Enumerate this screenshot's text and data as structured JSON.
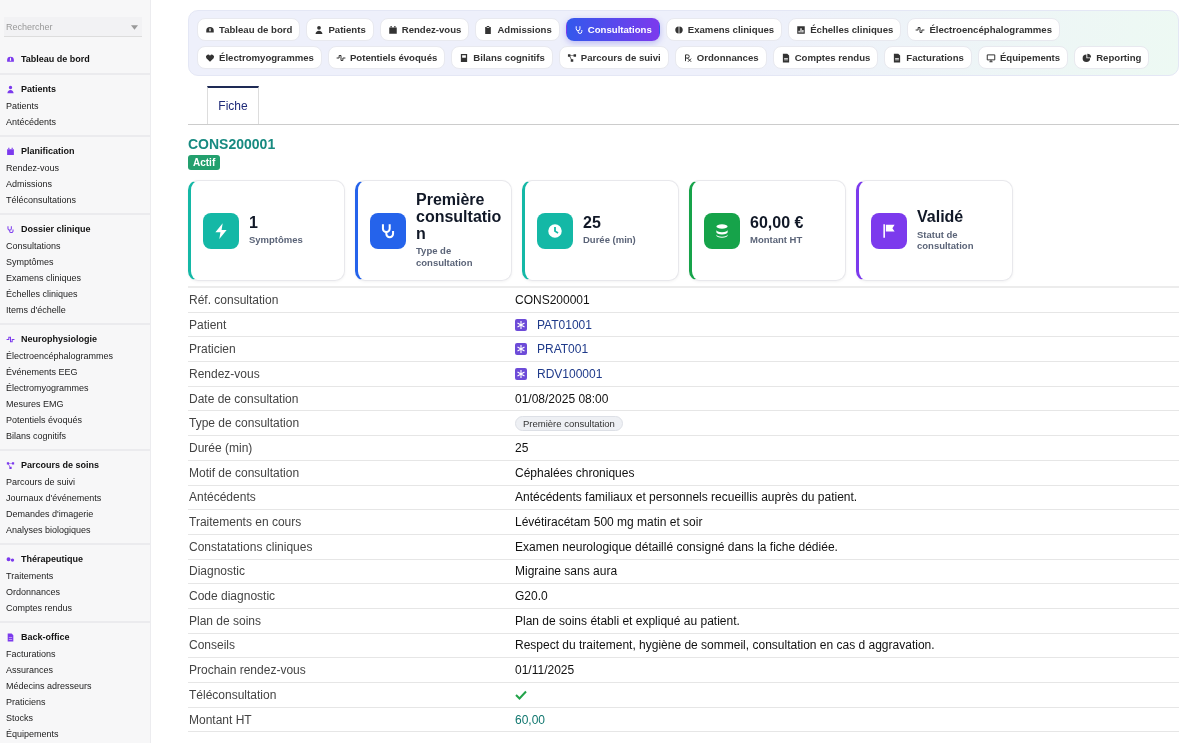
{
  "sidebar": {
    "search": {
      "placeholder": "Rechercher"
    },
    "sections": [
      {
        "title": "Tableau de bord"
      },
      {
        "title": "Patients",
        "items": [
          "Patients",
          "Antécédents"
        ]
      },
      {
        "title": "Planification",
        "items": [
          "Rendez-vous",
          "Admissions",
          "Téléconsultations"
        ]
      },
      {
        "title": "Dossier clinique",
        "items": [
          "Consultations",
          "Symptômes",
          "Examens cliniques",
          "Échelles cliniques",
          "Items d'échelle"
        ]
      },
      {
        "title": "Neurophysiologie",
        "items": [
          "Électroencéphalogrammes",
          "Événements EEG",
          "Électromyogrammes",
          "Mesures EMG",
          "Potentiels évoqués",
          "Bilans cognitifs"
        ]
      },
      {
        "title": "Parcours de soins",
        "items": [
          "Parcours de suivi",
          "Journaux d'événements",
          "Demandes d'imagerie",
          "Analyses biologiques"
        ]
      },
      {
        "title": "Thérapeutique",
        "items": [
          "Traitements",
          "Ordonnances",
          "Comptes rendus"
        ]
      },
      {
        "title": "Back-office",
        "items": [
          "Facturations",
          "Assurances",
          "Médecins adresseurs",
          "Praticiens",
          "Stocks",
          "Équipements"
        ]
      }
    ]
  },
  "nav": [
    {
      "label": "Tableau de bord",
      "selected": false
    },
    {
      "label": "Patients",
      "selected": false
    },
    {
      "label": "Rendez-vous",
      "selected": false
    },
    {
      "label": "Admissions",
      "selected": false
    },
    {
      "label": "Consultations",
      "selected": true
    },
    {
      "label": "Examens cliniques",
      "selected": false
    },
    {
      "label": "Échelles cliniques",
      "selected": false
    },
    {
      "label": "Électroencéphalogrammes",
      "selected": false
    },
    {
      "label": "Électromyogrammes",
      "selected": false
    },
    {
      "label": "Potentiels évoqués",
      "selected": false
    },
    {
      "label": "Bilans cognitifs",
      "selected": false
    },
    {
      "label": "Parcours de suivi",
      "selected": false
    },
    {
      "label": "Ordonnances",
      "selected": false
    },
    {
      "label": "Comptes rendus",
      "selected": false
    },
    {
      "label": "Facturations",
      "selected": false
    },
    {
      "label": "Équipements",
      "selected": false
    },
    {
      "label": "Reporting",
      "selected": false
    }
  ],
  "tabs": [
    {
      "label": "Fiche",
      "selected": true
    }
  ],
  "record": {
    "title": "CONS200001",
    "status": "Actif"
  },
  "cards": [
    {
      "value": "1",
      "label": "Symptômes",
      "color": "#14b8a6"
    },
    {
      "value": "Première consultation",
      "label": "Type de consultation",
      "color": "#2563eb"
    },
    {
      "value": "25",
      "label": "Durée (min)",
      "color": "#14b8a6"
    },
    {
      "value": "60,00 €",
      "label": "Montant HT",
      "color": "#16a34a"
    },
    {
      "value": "Validé",
      "label": "Statut de consultation",
      "color": "#7c3aed"
    }
  ],
  "details": [
    {
      "label": "Réf. consultation",
      "value": "CONS200001",
      "kind": "text"
    },
    {
      "label": "Patient",
      "value": "PAT01001",
      "kind": "link"
    },
    {
      "label": "Praticien",
      "value": "PRAT001",
      "kind": "link"
    },
    {
      "label": "Rendez-vous",
      "value": "RDV100001",
      "kind": "link"
    },
    {
      "label": "Date de consultation",
      "value": "01/08/2025 08:00",
      "kind": "text"
    },
    {
      "label": "Type de consultation",
      "value": "Première consultation",
      "kind": "tag"
    },
    {
      "label": "Durée (min)",
      "value": "25",
      "kind": "text"
    },
    {
      "label": "Motif de consultation",
      "value": "Céphalées chroniques",
      "kind": "text"
    },
    {
      "label": "Antécédents",
      "value": "Antécédents familiaux et personnels recueillis auprès du patient.",
      "kind": "text"
    },
    {
      "label": "Traitements en cours",
      "value": "Lévétiracétam 500 mg matin et soir",
      "kind": "text"
    },
    {
      "label": "Constatations cliniques",
      "value": "Examen neurologique détaillé consigné dans la fiche dédiée.",
      "kind": "text"
    },
    {
      "label": "Diagnostic",
      "value": "Migraine sans aura",
      "kind": "text"
    },
    {
      "label": "Code diagnostic",
      "value": "G20.0",
      "kind": "text"
    },
    {
      "label": "Plan de soins",
      "value": "Plan de soins établi et expliqué au patient.",
      "kind": "text"
    },
    {
      "label": "Conseils",
      "value": "Respect du traitement, hygiène de sommeil, consultation en cas d aggravation.",
      "kind": "text"
    },
    {
      "label": "Prochain rendez-vous",
      "value": "01/11/2025",
      "kind": "text"
    },
    {
      "label": "Téléconsultation",
      "checked": true,
      "kind": "check"
    },
    {
      "label": "Montant HT",
      "value": "60,00",
      "kind": "money"
    }
  ]
}
